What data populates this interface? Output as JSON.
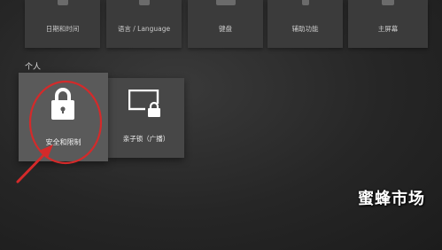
{
  "top_row": {
    "tiles": [
      {
        "label": "日期和时间"
      },
      {
        "label": "语言 / Language"
      },
      {
        "label": "键盘"
      },
      {
        "label": "辅助功能"
      },
      {
        "label": "主屏幕"
      }
    ]
  },
  "personal": {
    "section_label": "个人",
    "tiles": [
      {
        "label": "安全和限制",
        "icon": "lock-icon",
        "focused": true
      },
      {
        "label": "亲子锁（广播）",
        "icon": "monitor-lock-icon",
        "focused": false
      }
    ]
  },
  "annotation": {
    "color": "#d42a2a",
    "shape": "circle-with-arrow"
  },
  "watermark": {
    "text": "蜜蜂市场"
  }
}
